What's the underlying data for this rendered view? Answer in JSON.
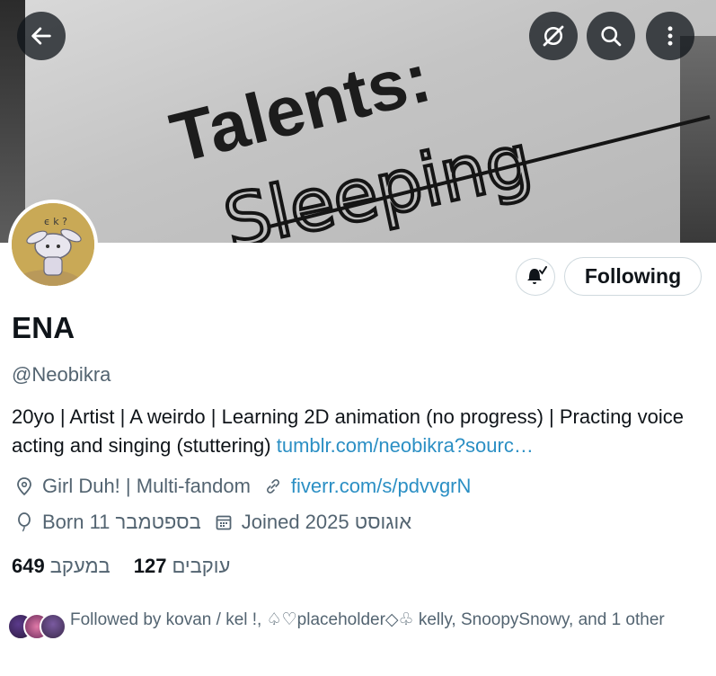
{
  "banner": {
    "line1": "Talents:",
    "line2": "Sleeping"
  },
  "topbar": {
    "back_icon": "arrow-left-icon",
    "mute_icon": "eye-slash-icon",
    "search_icon": "search-icon",
    "more_icon": "more-vertical-icon"
  },
  "profile": {
    "name": "ENA",
    "handle": "@Neobikra",
    "bio_text": "20yo | Artist | A weirdo | Learning 2D animation (no progress)  | Practing voice acting and singing (stuttering) ",
    "bio_link": "tumblr.com/neobikra?sourc…",
    "location": "Girl Duh! | Multi-fandom",
    "website": "fiverr.com/s/pdvvgrN",
    "birthday": "Born 11 בספטמבר",
    "joined": "Joined 2025 אוגוסט"
  },
  "actions": {
    "notify_icon": "bell-check-icon",
    "follow_label": "Following"
  },
  "stats": {
    "following_count": "649",
    "following_label": "במעקב",
    "followers_count": "127",
    "followers_label": "עוקבים"
  },
  "followed_by": {
    "text": "Followed by kovan / kel !, ♤♡placeholder◇♧ kelly, SnoopySnowy, and 1 other"
  },
  "colors": {
    "link": "#2b8fc4",
    "secondary_text": "#536471",
    "primary_text": "#0f1419",
    "border": "#cfd9de"
  }
}
